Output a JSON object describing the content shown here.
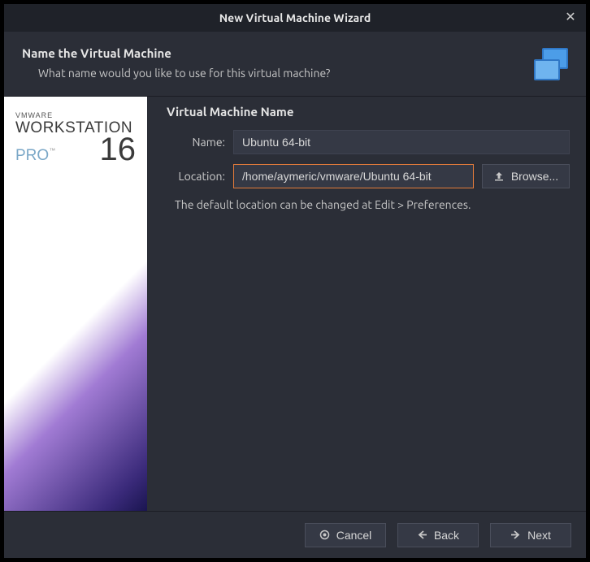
{
  "titlebar": {
    "title": "New Virtual Machine Wizard"
  },
  "header": {
    "title": "Name the Virtual Machine",
    "subtitle": "What name would you like to use for this virtual machine?"
  },
  "brand": {
    "vmware": "VMWARE",
    "workstation": "WORKSTATION",
    "pro": "PRO",
    "version": "16"
  },
  "form": {
    "section": "Virtual Machine Name",
    "name_label": "Name:",
    "name_value": "Ubuntu 64-bit",
    "location_label": "Location:",
    "location_value": "/home/aymeric/vmware/Ubuntu 64-bit",
    "browse_label": "Browse...",
    "hint": "The default location can be changed at Edit > Preferences."
  },
  "footer": {
    "cancel": "Cancel",
    "back": "Back",
    "next": "Next"
  }
}
